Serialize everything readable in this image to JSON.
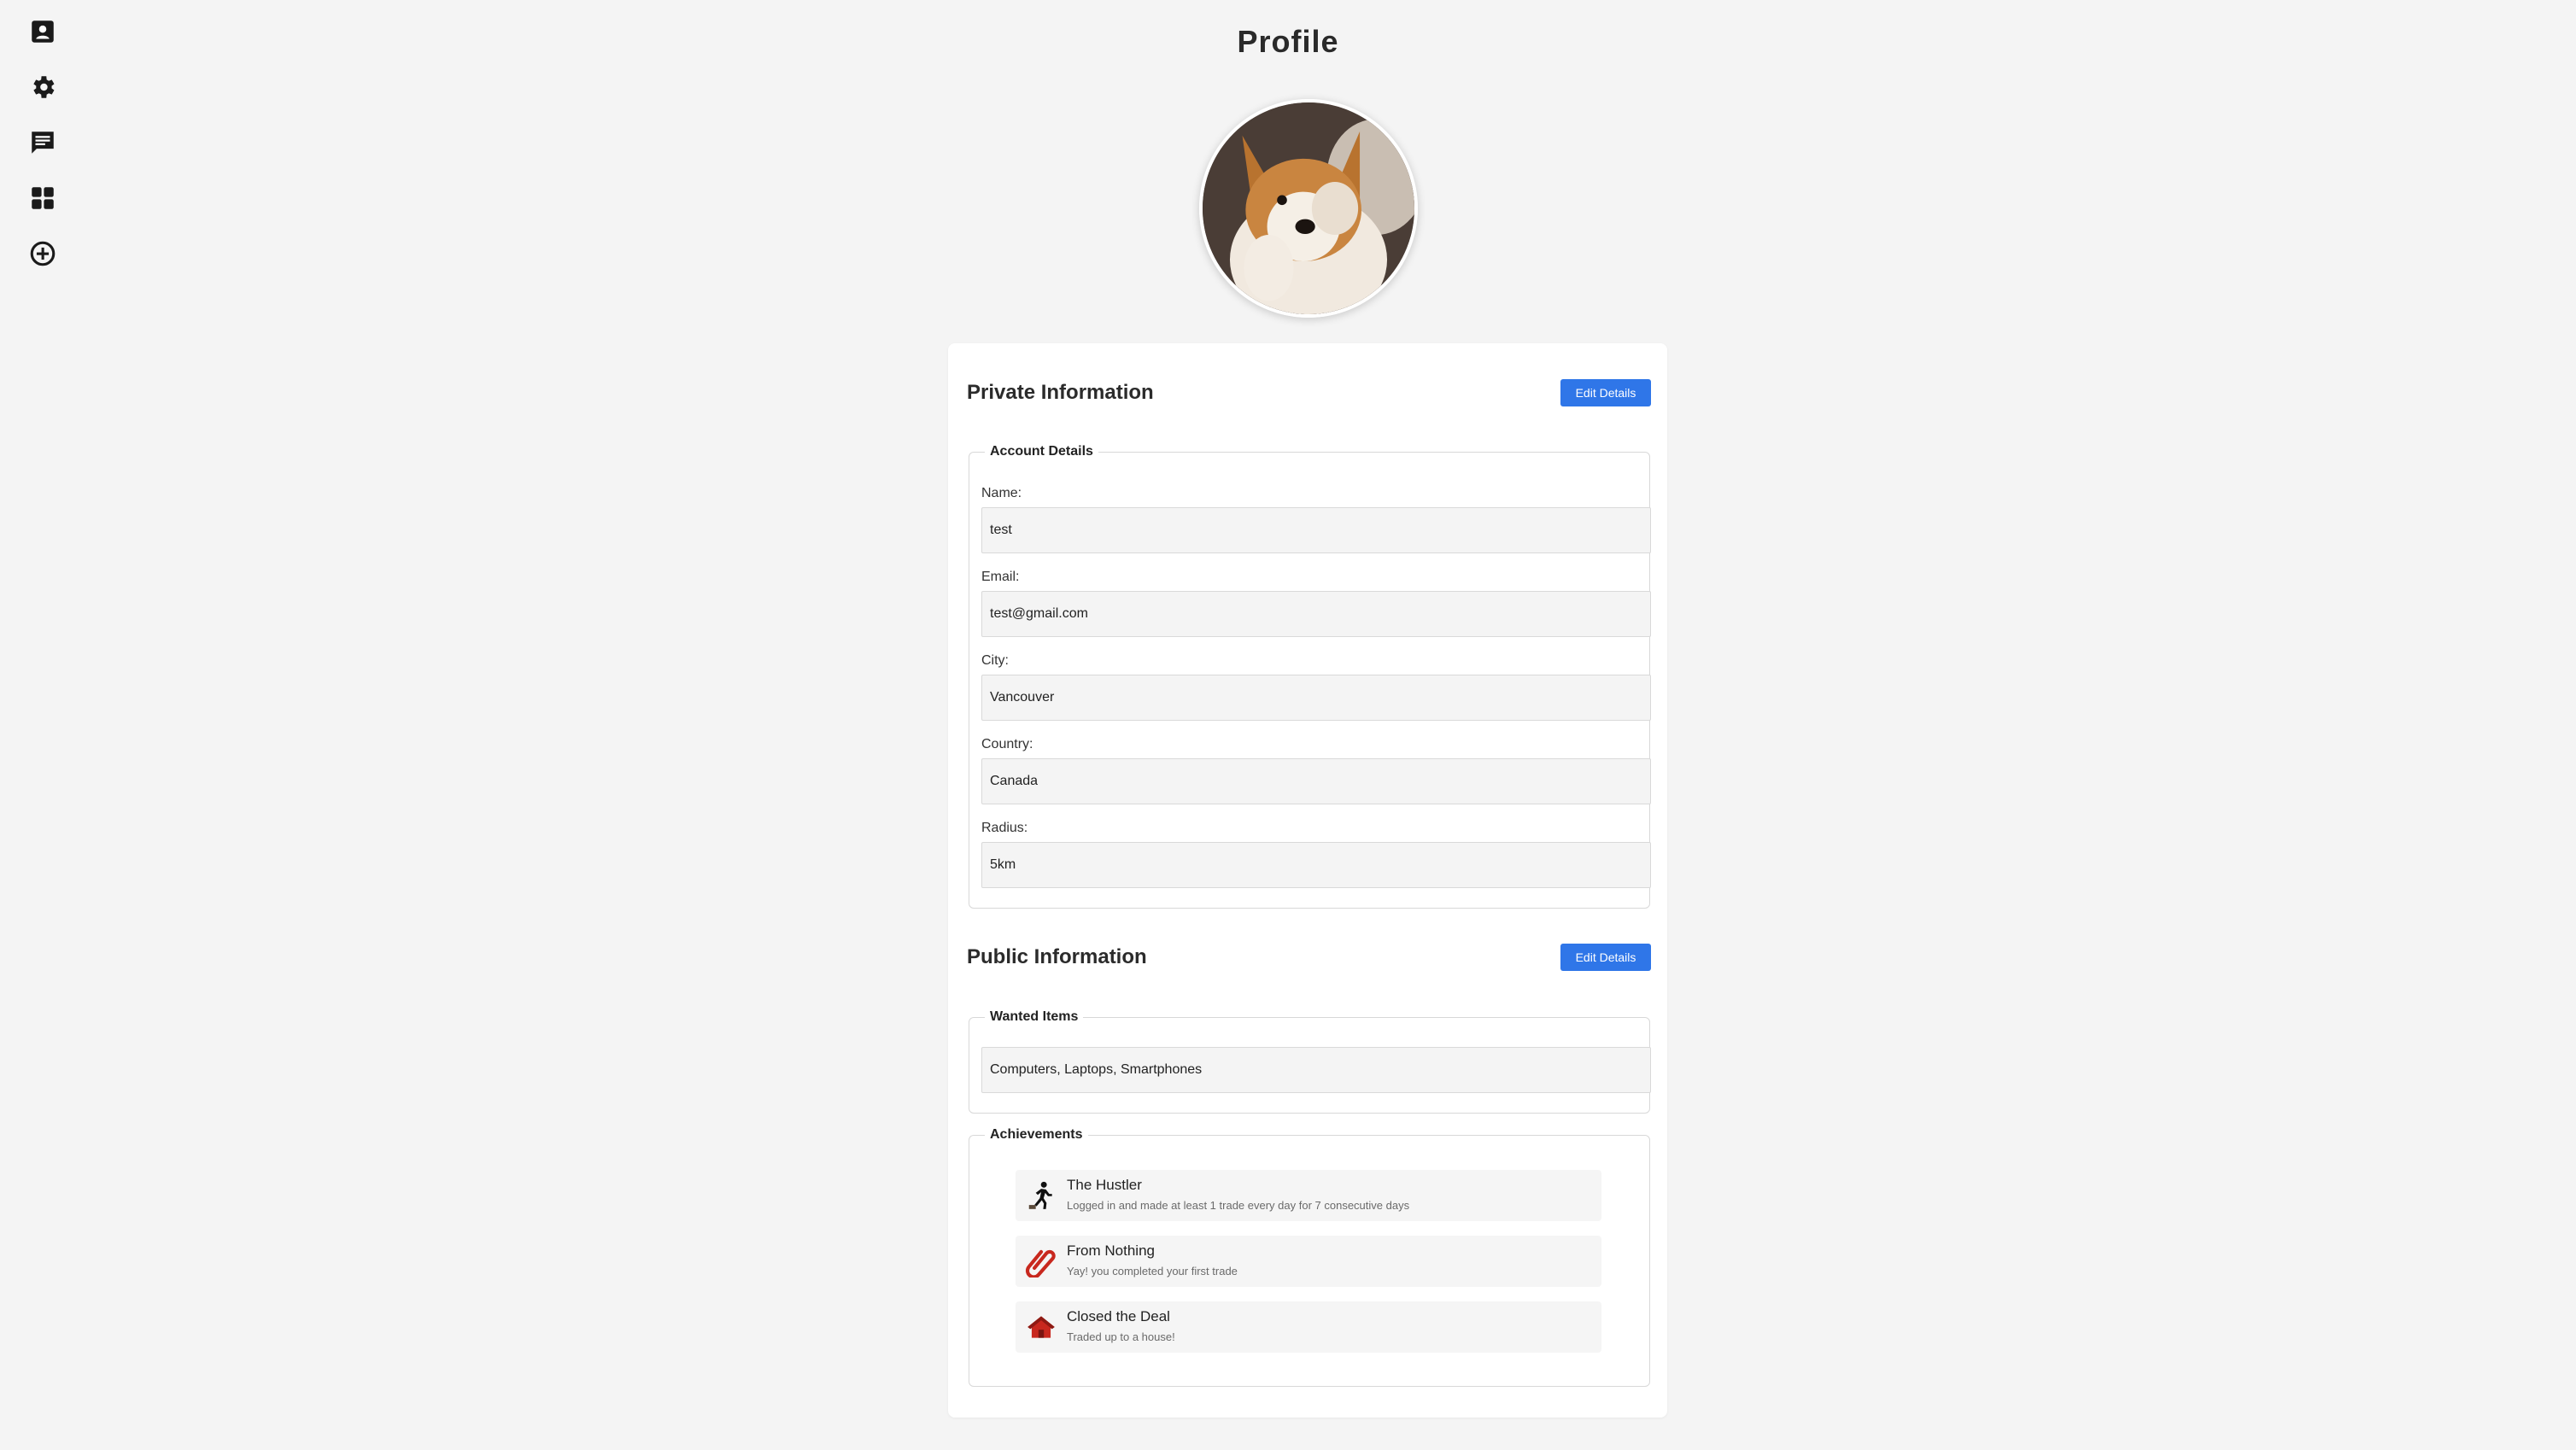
{
  "page": {
    "title": "Profile"
  },
  "sidebar": {
    "items": [
      {
        "icon": "contact-card-icon"
      },
      {
        "icon": "gear-icon"
      },
      {
        "icon": "chat-icon"
      },
      {
        "icon": "dashboard-grid-icon"
      },
      {
        "icon": "add-circle-icon"
      }
    ]
  },
  "avatar": {
    "alt": "Corgi puppy profile photo"
  },
  "private_info": {
    "heading": "Private Information",
    "edit_label": "Edit Details",
    "group_label": "Account Details",
    "fields": {
      "name": {
        "label": "Name:",
        "value": "test"
      },
      "email": {
        "label": "Email:",
        "value": "test@gmail.com"
      },
      "city": {
        "label": "City:",
        "value": "Vancouver"
      },
      "country": {
        "label": "Country:",
        "value": "Canada"
      },
      "radius": {
        "label": "Radius:",
        "value": "5km"
      }
    }
  },
  "public_info": {
    "heading": "Public Information",
    "edit_label": "Edit Details",
    "wanted_label": "Wanted Items",
    "wanted_value": "Computers, Laptops, Smartphones",
    "achievements_label": "Achievements",
    "achievements": [
      {
        "icon": "runner-icon",
        "title": "The Hustler",
        "description": "Logged in and made at least 1 trade every day for 7 consecutive days"
      },
      {
        "icon": "paperclip-icon",
        "title": "From Nothing",
        "description": "Yay! you completed your first trade"
      },
      {
        "icon": "house-icon",
        "title": "Closed the Deal",
        "description": "Traded up to a house!"
      }
    ]
  },
  "colors": {
    "accent": "#2f76e8",
    "background": "#f4f4f4"
  }
}
